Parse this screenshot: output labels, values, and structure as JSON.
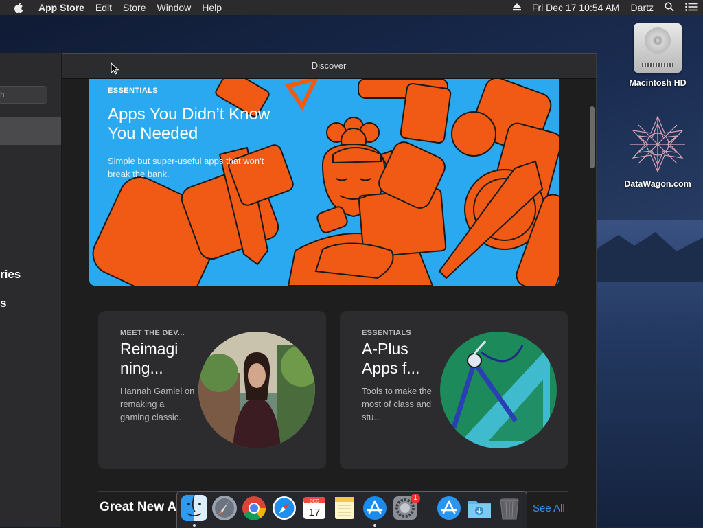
{
  "menubar": {
    "app_name": "App Store",
    "items": [
      "Edit",
      "Store",
      "Window",
      "Help"
    ],
    "datetime": "Fri Dec 17  10:54 AM",
    "user": "Dartz"
  },
  "desktop": {
    "icons": [
      {
        "label": "Macintosh HD"
      },
      {
        "label": "DataWagon.com"
      }
    ]
  },
  "sidebar": {
    "search_placeholder": "h",
    "items": [
      "ries",
      "s"
    ]
  },
  "window": {
    "title": "Discover"
  },
  "hero": {
    "eyebrow": "ESSENTIALS",
    "title": "Apps You Didn’t Know You Needed",
    "description": "Simple but super-useful apps that won't break the bank.",
    "background_color": "#2aa8f0",
    "accent_color": "#f05a14"
  },
  "cards": [
    {
      "eyebrow": "MEET THE DEV...",
      "title": "Reimagi ning...",
      "description": "Hannah Gamiel on remaking a gaming classic."
    },
    {
      "eyebrow": "ESSENTIALS",
      "title": "A-Plus Apps f...",
      "description": "Tools to make the most of class and stu..."
    }
  ],
  "section": {
    "title": "Great New A",
    "see_all": "See All"
  },
  "dock": {
    "items": [
      {
        "name": "finder-icon",
        "running": true
      },
      {
        "name": "launchpad-icon",
        "running": false
      },
      {
        "name": "chrome-icon",
        "running": false
      },
      {
        "name": "safari-icon",
        "running": false
      },
      {
        "name": "calendar-icon",
        "running": false,
        "month": "DEC",
        "day": "17"
      },
      {
        "name": "notes-icon",
        "running": false
      },
      {
        "name": "app-store-icon",
        "running": true
      },
      {
        "name": "system-preferences-icon",
        "running": false,
        "badge": "1"
      },
      {
        "name": "app-store-folder-icon",
        "running": false
      },
      {
        "name": "downloads-folder-icon",
        "running": false
      },
      {
        "name": "trash-icon",
        "running": false
      }
    ]
  },
  "colors": {
    "link": "#3b8eea",
    "window_bg": "#1e1e1e",
    "card_bg": "#2c2c2e"
  }
}
